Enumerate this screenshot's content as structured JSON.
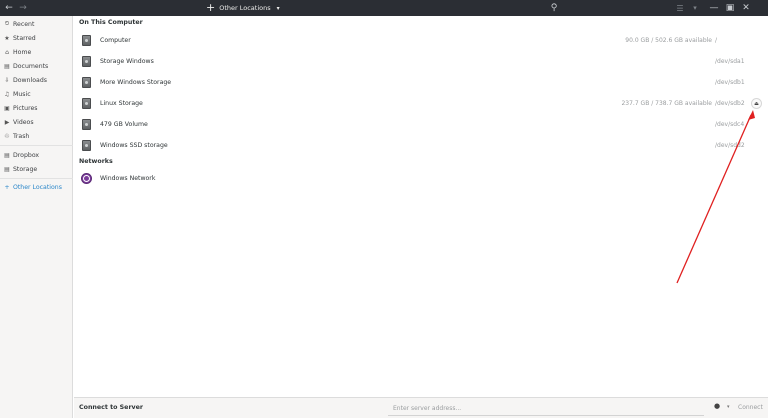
{
  "header": {
    "back_icon": "←",
    "forward_icon": "→",
    "path_title": "Other Locations",
    "path_plus_icon": "+",
    "path_caret_icon": "▾",
    "search_icon": "⚲",
    "view_list_icon": "☰",
    "view_menu_icon": "▾",
    "minimize_icon": "—",
    "maximize_icon": "▣",
    "close_icon": "✕"
  },
  "sidebar": {
    "items": [
      {
        "icon": "⏲",
        "label": "Recent"
      },
      {
        "icon": "★",
        "label": "Starred"
      },
      {
        "icon": "⌂",
        "label": "Home"
      },
      {
        "icon": "▤",
        "label": "Documents"
      },
      {
        "icon": "⇩",
        "label": "Downloads"
      },
      {
        "icon": "♫",
        "label": "Music"
      },
      {
        "icon": "▣",
        "label": "Pictures"
      },
      {
        "icon": "▶",
        "label": "Videos"
      },
      {
        "icon": "♲",
        "label": "Trash"
      },
      {
        "icon": "▤",
        "label": "Dropbox"
      },
      {
        "icon": "▤",
        "label": "Storage"
      },
      {
        "icon": "+",
        "label": "Other Locations"
      }
    ]
  },
  "main": {
    "computer_section_title": "On This Computer",
    "drives": [
      {
        "name": "Computer",
        "space": "90.0 GB / 502.6 GB available",
        "device": "/"
      },
      {
        "name": "Storage Windows",
        "space": "",
        "device": "/dev/sda1"
      },
      {
        "name": "More Windows Storage",
        "space": "",
        "device": "/dev/sdb1"
      },
      {
        "name": "Linux Storage",
        "space": "237.7 GB / 738.7 GB available",
        "device": "/dev/sdb2",
        "eject_icon": "⏏"
      },
      {
        "name": "479 GB Volume",
        "space": "",
        "device": "/dev/sdc4"
      },
      {
        "name": "Windows SSD storage",
        "space": "",
        "device": "/dev/sdd2"
      }
    ],
    "networks_section_title": "Networks",
    "networks": [
      {
        "name": "Windows Network"
      }
    ]
  },
  "bottombar": {
    "connect_label": "Connect to Server",
    "server_placeholder": "Enter server address...",
    "server_value": "",
    "help_icon": "●",
    "dropdown_icon": "▾",
    "connect_button": "Connect"
  },
  "annotation": {
    "arrow_color": "#e02020"
  }
}
